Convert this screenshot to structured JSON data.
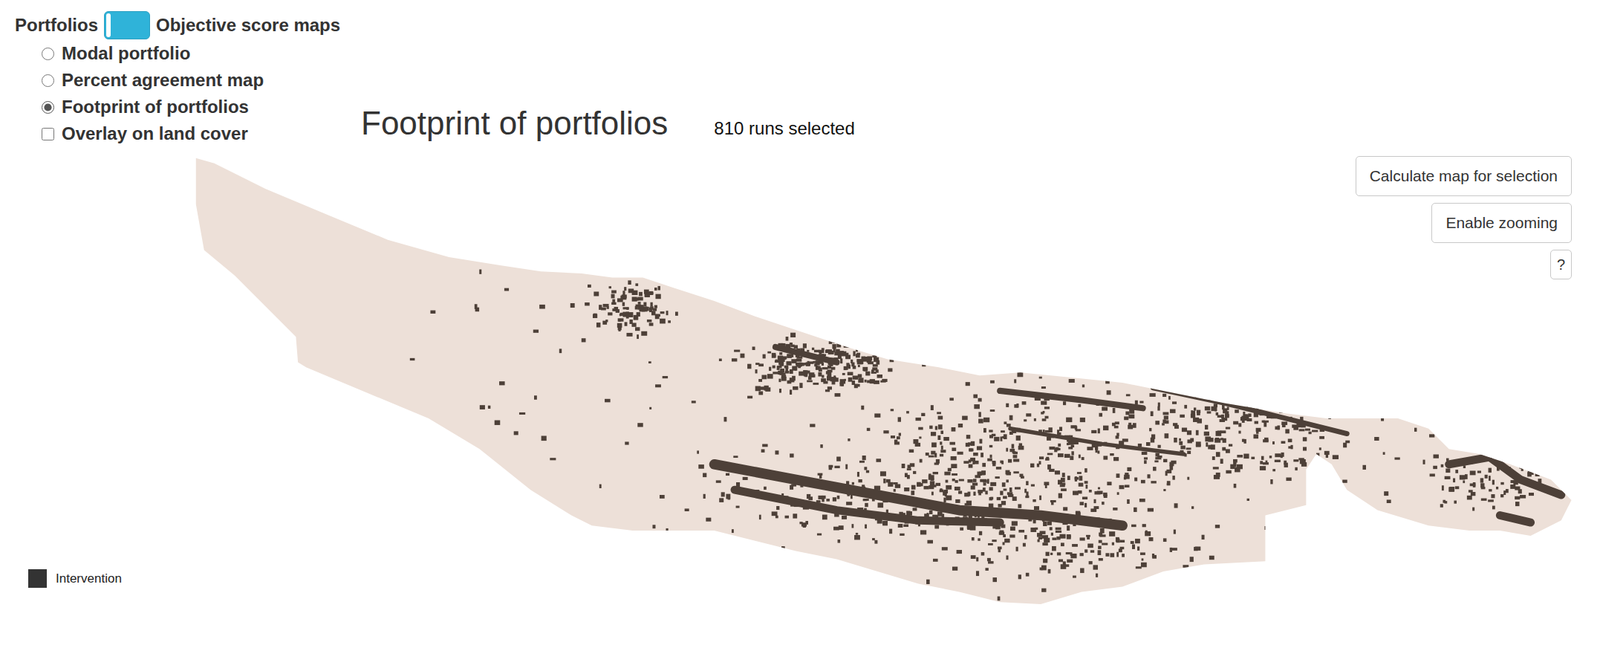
{
  "toggle": {
    "left_label": "Portfolios",
    "right_label": "Objective score maps",
    "on": false
  },
  "options": [
    {
      "label": "Modal portfolio",
      "kind": "radio",
      "selected": false
    },
    {
      "label": "Percent agreement map",
      "kind": "radio",
      "selected": false
    },
    {
      "label": "Footprint of portfolios",
      "kind": "radio",
      "selected": true
    },
    {
      "label": "Overlay on land cover",
      "kind": "checkbox",
      "checked": false
    }
  ],
  "map": {
    "title": "Footprint of portfolios",
    "runs": "810 runs selected"
  },
  "buttons": [
    {
      "label": "Calculate map for selection"
    },
    {
      "label": "Enable zooming"
    },
    {
      "label": "?"
    }
  ],
  "legend": [
    {
      "label": "Intervention"
    }
  ]
}
